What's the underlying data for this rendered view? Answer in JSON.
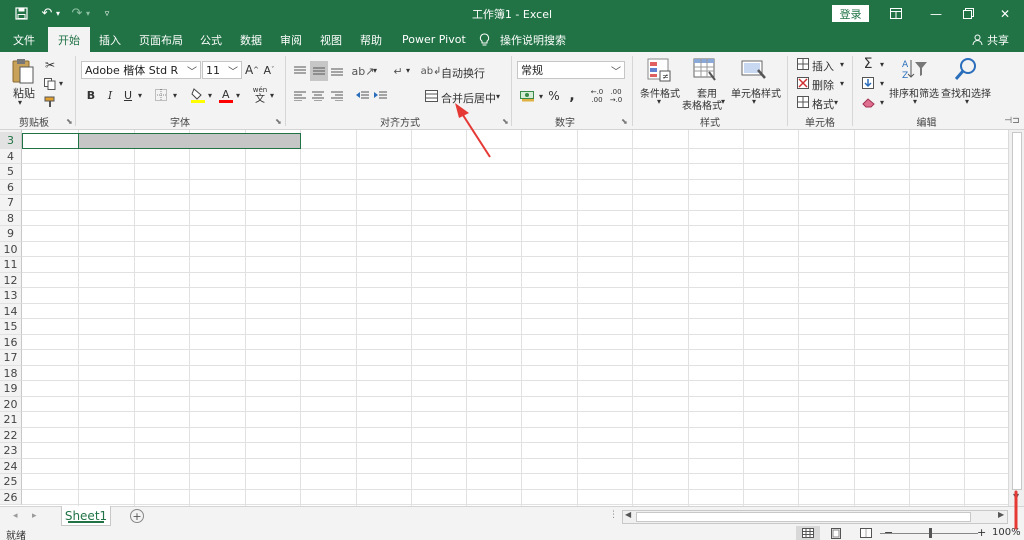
{
  "titlebar": {
    "title": "工作簿1  -  Excel",
    "login": "登录",
    "save_icon": "save-icon",
    "undo_icon": "undo-icon",
    "redo_icon": "redo-icon",
    "customize_icon": "customize-qat-icon"
  },
  "tabs": {
    "items": [
      "文件",
      "开始",
      "插入",
      "页面布局",
      "公式",
      "数据",
      "审阅",
      "视图",
      "帮助",
      "Power Pivot",
      "操作说明搜索"
    ],
    "active": "开始",
    "share": "共享"
  },
  "ribbon": {
    "clipboard": {
      "paste": "粘贴",
      "label": "剪贴板"
    },
    "font": {
      "name": "Adobe 楷体 Std R",
      "size": "11",
      "bold": "B",
      "italic": "I",
      "underline": "U",
      "grow": "A",
      "shrink": "A",
      "fill_color": "#FFFF00",
      "font_color": "#FF0000",
      "label": "字体"
    },
    "alignment": {
      "wrap": "自动换行",
      "merge": "合并后居中",
      "label": "对齐方式"
    },
    "number": {
      "format": "常规",
      "percent": "%",
      "comma": ",",
      "label": "数字"
    },
    "styles": {
      "conditional": "条件格式",
      "table1": "套用",
      "table2": "表格格式",
      "cell_styles": "单元格样式",
      "label": "样式"
    },
    "cells": {
      "insert": "插入",
      "delete": "删除",
      "format": "格式",
      "label": "单元格"
    },
    "editing": {
      "sum": "Σ",
      "sort": "排序和筛选",
      "find": "查找和选择",
      "label": "编辑"
    }
  },
  "grid": {
    "rows": [
      "3",
      "4",
      "5",
      "6",
      "7",
      "8",
      "9",
      "10",
      "11",
      "12",
      "13",
      "14",
      "15",
      "16",
      "17",
      "18",
      "19",
      "20",
      "21",
      "22",
      "23",
      "24",
      "25",
      "26"
    ]
  },
  "sheets": {
    "tabs": [
      "Sheet1"
    ],
    "add": "+"
  },
  "status": {
    "ready": "就绪",
    "zoom": "100%",
    "minus": "−",
    "plus": "+"
  },
  "colors": {
    "accent": "#217346",
    "annotation": "#E53935"
  }
}
